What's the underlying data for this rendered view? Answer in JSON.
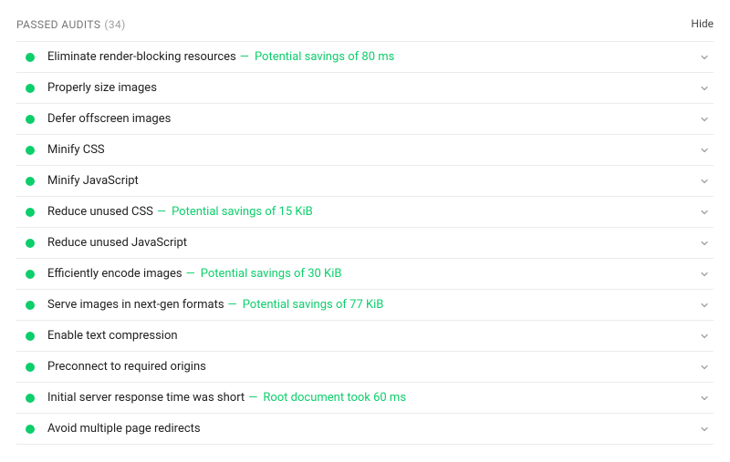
{
  "header": {
    "title": "PASSED AUDITS",
    "count_display": "(34)",
    "hide_label": "Hide"
  },
  "audits": [
    {
      "label": "Eliminate render-blocking resources",
      "detail": "Potential savings of 80 ms"
    },
    {
      "label": "Properly size images",
      "detail": null
    },
    {
      "label": "Defer offscreen images",
      "detail": null
    },
    {
      "label": "Minify CSS",
      "detail": null
    },
    {
      "label": "Minify JavaScript",
      "detail": null
    },
    {
      "label": "Reduce unused CSS",
      "detail": "Potential savings of 15 KiB"
    },
    {
      "label": "Reduce unused JavaScript",
      "detail": null
    },
    {
      "label": "Efficiently encode images",
      "detail": "Potential savings of 30 KiB"
    },
    {
      "label": "Serve images in next-gen formats",
      "detail": "Potential savings of 77 KiB"
    },
    {
      "label": "Enable text compression",
      "detail": null
    },
    {
      "label": "Preconnect to required origins",
      "detail": null
    },
    {
      "label": "Initial server response time was short",
      "detail": "Root document took 60 ms"
    },
    {
      "label": "Avoid multiple page redirects",
      "detail": null
    }
  ]
}
